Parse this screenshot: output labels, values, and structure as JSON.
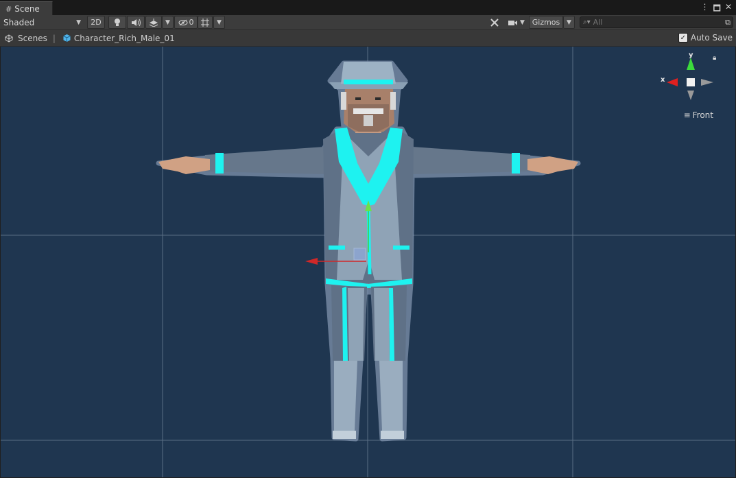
{
  "window": {
    "tab_label": "Scene",
    "tab_icon": "hash-grid-icon"
  },
  "toolbar": {
    "shading_mode": "Shaded",
    "two_d_label": "2D",
    "hidden_count": "0",
    "gizmos_label": "Gizmos",
    "search_placeholder": "All"
  },
  "breadcrumb": {
    "root_label": "Scenes",
    "separator": "|",
    "prefab_label": "Character_Rich_Male_01"
  },
  "autosave": {
    "label": "Auto Save",
    "checked": true
  },
  "orientation_gizmo": {
    "x_label": "x",
    "y_label": "y",
    "view_label": "Front"
  },
  "colors": {
    "viewport_bg": "#1f3650",
    "selection_outline": "#00ffff",
    "axis_x": "#e02020",
    "axis_y": "#3cdc3c"
  }
}
